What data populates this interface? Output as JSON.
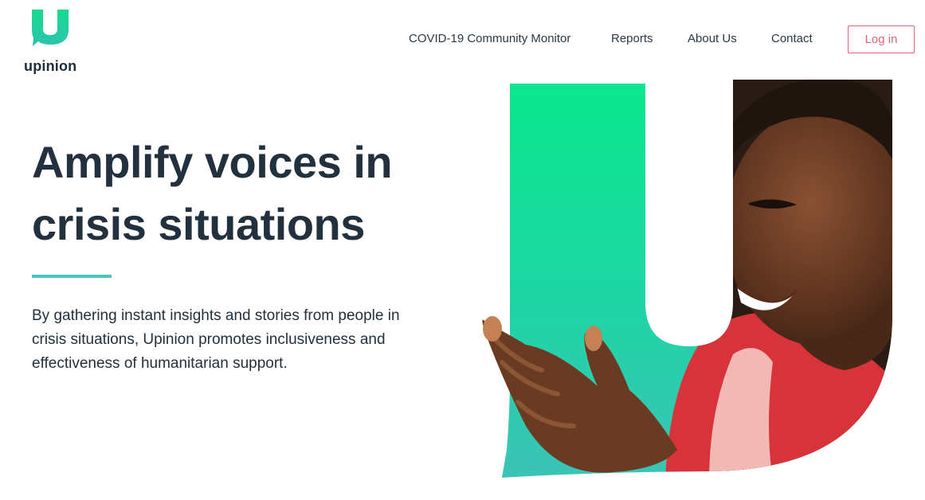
{
  "brand": {
    "name": "upinion",
    "accent": "#18d38e",
    "login_color": "#e36275"
  },
  "nav": {
    "items": [
      {
        "label": "COVID-19 Community Monitor"
      },
      {
        "label": "Reports"
      },
      {
        "label": "About Us"
      },
      {
        "label": "Contact"
      }
    ],
    "login_label": "Log in"
  },
  "hero": {
    "title": "Amplify voices in crisis situations",
    "body": "By gathering instant insights and stories from people in crisis situations, Upinion promotes inclusiveness and effectiveness of humanitarian support.",
    "image": "woman-clapping-hands-photo",
    "shape": "U-letterform-green-gradient"
  }
}
